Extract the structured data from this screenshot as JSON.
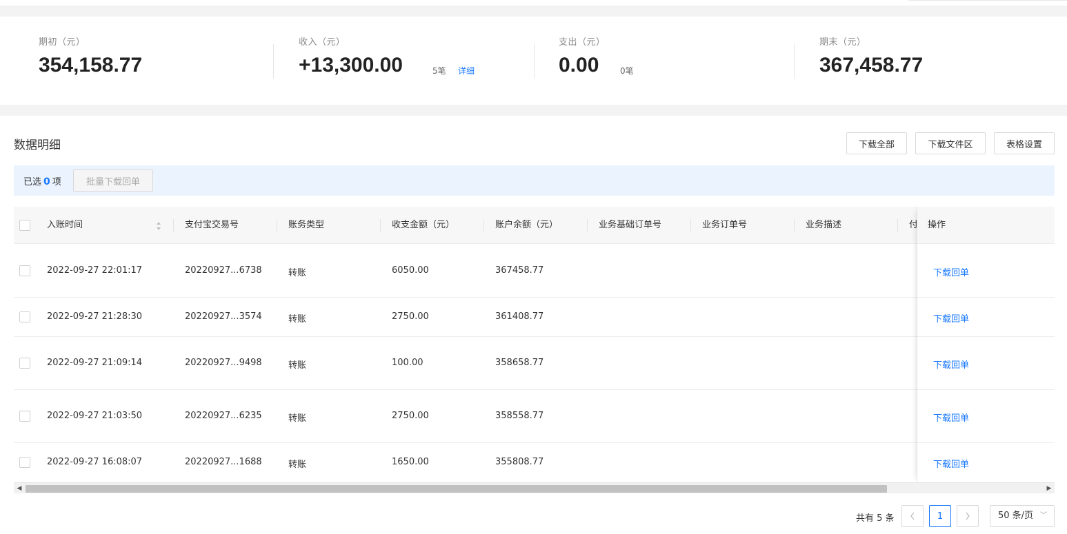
{
  "summary": {
    "opening": {
      "label": "期初（元）",
      "value": "354,158.77"
    },
    "income": {
      "label": "收入（元）",
      "value": "+13,300.00",
      "count": "5笔",
      "detail_link": "详细"
    },
    "expense": {
      "label": "支出（元）",
      "value": "0.00",
      "count": "0笔"
    },
    "closing": {
      "label": "期末（元）",
      "value": "367,458.77"
    }
  },
  "section": {
    "title": "数据明细",
    "buttons": {
      "download_all": "下载全部",
      "download_area": "下载文件区",
      "table_settings": "表格设置"
    }
  },
  "selection": {
    "prefix": "已选",
    "count": "0",
    "suffix": "项",
    "batch_button": "批量下载回单"
  },
  "table": {
    "columns": [
      "入账时间",
      "支付宝交易号",
      "账务类型",
      "收支金额（元）",
      "账户余额（元）",
      "业务基础订单号",
      "业务订单号",
      "业务描述",
      "付",
      "操作"
    ],
    "rows": [
      {
        "time": "2022-09-27 22:01:17",
        "trade_no": "20220927...6738",
        "type": "转账",
        "amount": "6050.00",
        "balance": "367458.77",
        "action": "下载回单"
      },
      {
        "time": "2022-09-27 21:28:30",
        "trade_no": "20220927...3574",
        "type": "转账",
        "amount": "2750.00",
        "balance": "361408.77",
        "action": "下载回单"
      },
      {
        "time": "2022-09-27 21:09:14",
        "trade_no": "20220927...9498",
        "type": "转账",
        "amount": "100.00",
        "balance": "358658.77",
        "action": "下载回单"
      },
      {
        "time": "2022-09-27 21:03:50",
        "trade_no": "20220927...6235",
        "type": "转账",
        "amount": "2750.00",
        "balance": "358558.77",
        "action": "下载回单"
      },
      {
        "time": "2022-09-27 16:08:07",
        "trade_no": "20220927...1688",
        "type": "转账",
        "amount": "1650.00",
        "balance": "355808.77",
        "action": "下载回单"
      }
    ]
  },
  "pagination": {
    "total": "共有 5 条",
    "current_page": "1",
    "page_size": "50 条/页"
  },
  "colors": {
    "accent": "#1677ff",
    "select_bar_bg": "#ebf3fe"
  }
}
